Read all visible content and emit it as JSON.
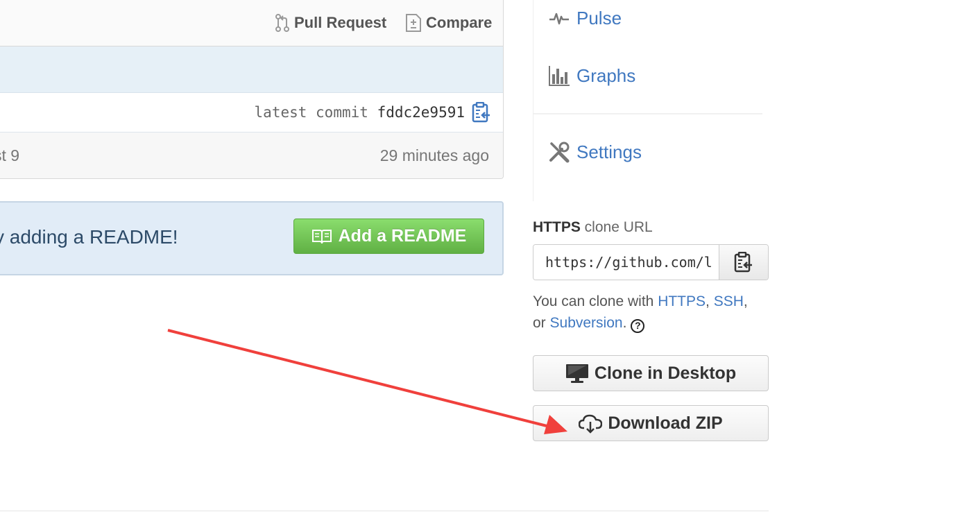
{
  "toolbar": {
    "pull_request_label": "Pull Request",
    "compare_label": "Compare"
  },
  "commit": {
    "label": "latest commit",
    "sha": "fddc2e9591"
  },
  "file_row": {
    "left_text": "st 9",
    "time": "29 minutes ago"
  },
  "readme": {
    "text": "y adding a README!",
    "button_label": "Add a README",
    "button_color": "#6cc644"
  },
  "sidebar": {
    "pulse_label": "Pulse",
    "graphs_label": "Graphs",
    "settings_label": "Settings",
    "link_color": "#4078c0"
  },
  "clone": {
    "title_bold": "HTTPS",
    "title_rest": " clone URL",
    "url_value": "https://github.com/l",
    "help_prefix": "You can clone with ",
    "https_link": "HTTPS",
    "sep1": ", ",
    "ssh_link": "SSH",
    "sep2": ",",
    "or_text": "or ",
    "subversion_link": "Subversion",
    "period": ".",
    "help_icon": "?"
  },
  "buttons": {
    "clone_desktop_label": "Clone in Desktop",
    "download_zip_label": "Download ZIP"
  },
  "annotation": {
    "arrow_color": "#f0403c"
  }
}
